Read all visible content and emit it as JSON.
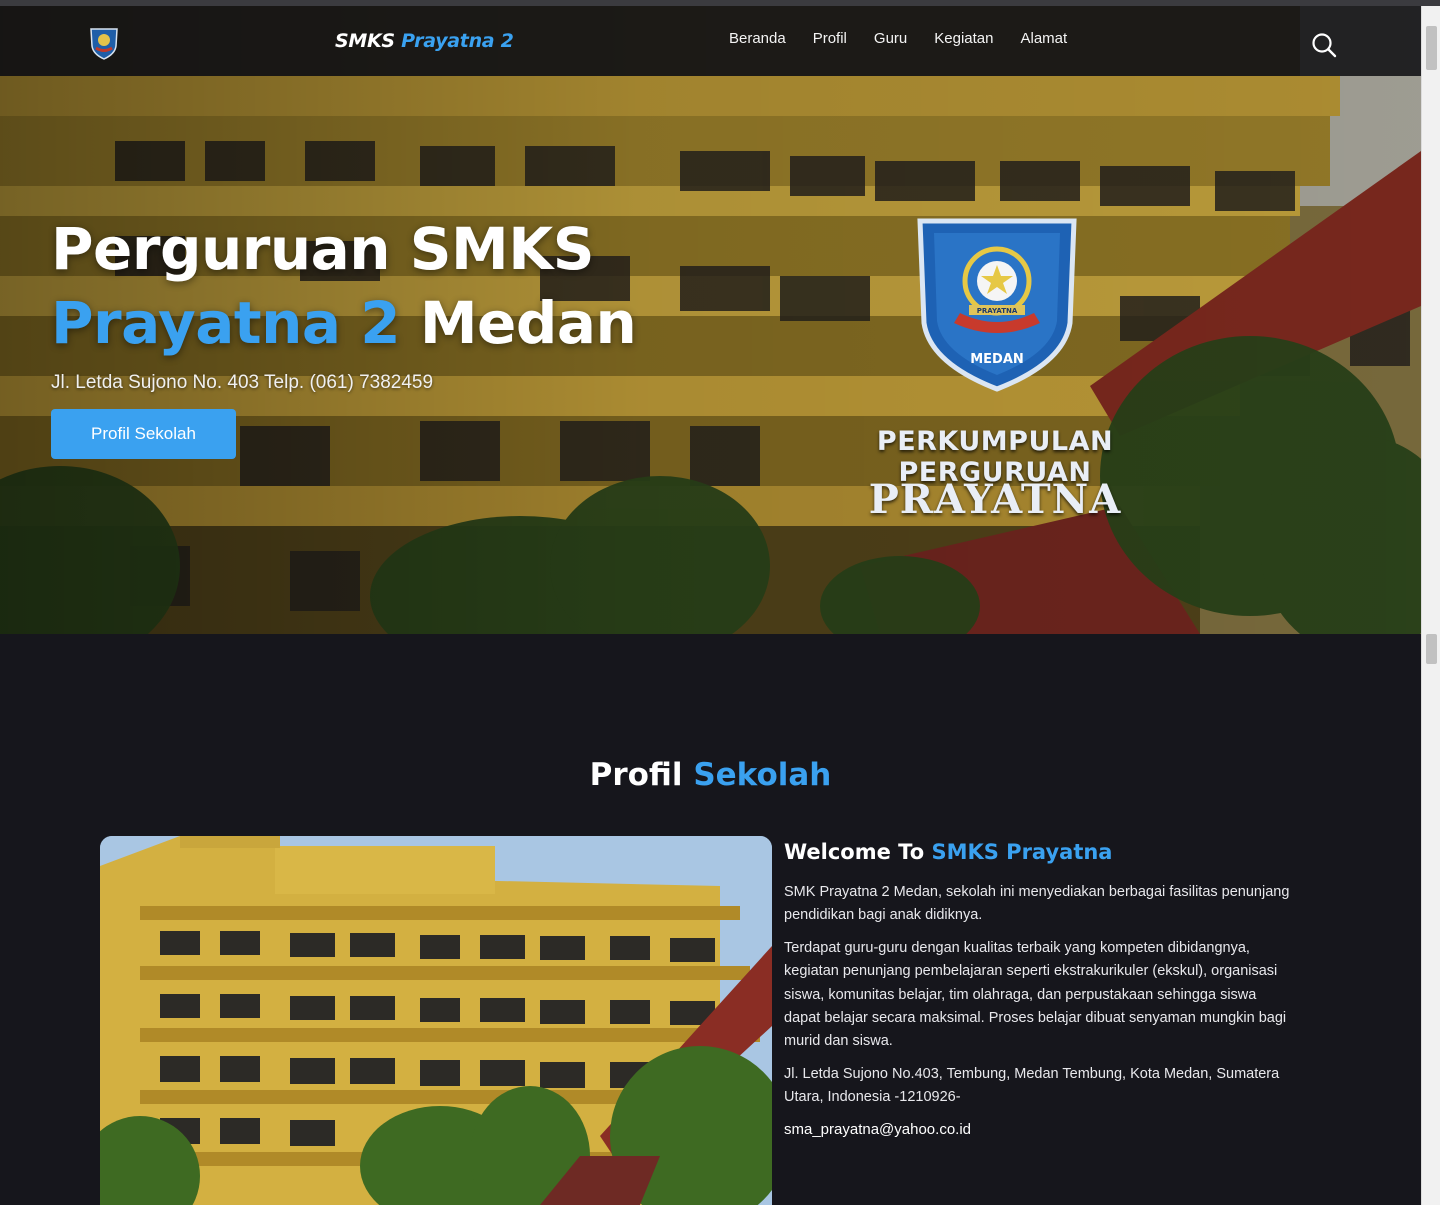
{
  "header": {
    "brand_part1": "SMKS",
    "brand_part2": "Prayatna 2",
    "nav": [
      "Beranda",
      "Profil",
      "Guru",
      "Kegiatan",
      "Alamat"
    ]
  },
  "hero": {
    "title_line1": "Perguruan SMKS",
    "title_blue": "Prayatna 2",
    "title_rest": "Medan",
    "address": "Jl. Letda Sujono No. 403 Telp. (061) 7382459",
    "button_label": "Profil Sekolah",
    "crest_text": "MEDAN",
    "crest_ribbon": "PRAYATNA",
    "org_line1": "PERKUMPULAN PERGURUAN",
    "org_line2": "PRAYATNA"
  },
  "profile": {
    "title_white": "Profil",
    "title_blue": "Sekolah",
    "welcome_white": "Welcome To",
    "welcome_blue": "SMKS Prayatna",
    "para1": "SMK Prayatna 2 Medan, sekolah ini menyediakan berbagai fasilitas penunjang pendidikan bagi anak didiknya.",
    "para2": "Terdapat guru-guru dengan kualitas terbaik yang kompeten dibidangnya, kegiatan penunjang pembelajaran seperti ekstrakurikuler (ekskul), organisasi siswa, komunitas belajar, tim olahraga, dan perpustakaan sehingga siswa dapat belajar secara maksimal. Proses belajar dibuat senyaman mungkin bagi murid dan siswa.",
    "address": "Jl. Letda Sujono No.403, Tembung, Medan Tembung, Kota Medan, Sumatera Utara, Indonesia -1210926-",
    "email": "sma_prayatna@yahoo.co.id"
  },
  "colors": {
    "accent": "#3aa1f0",
    "background": "#16161c",
    "header": "#0e0e12"
  },
  "icons": {
    "logo": "school-crest-icon",
    "search": "search-icon"
  }
}
